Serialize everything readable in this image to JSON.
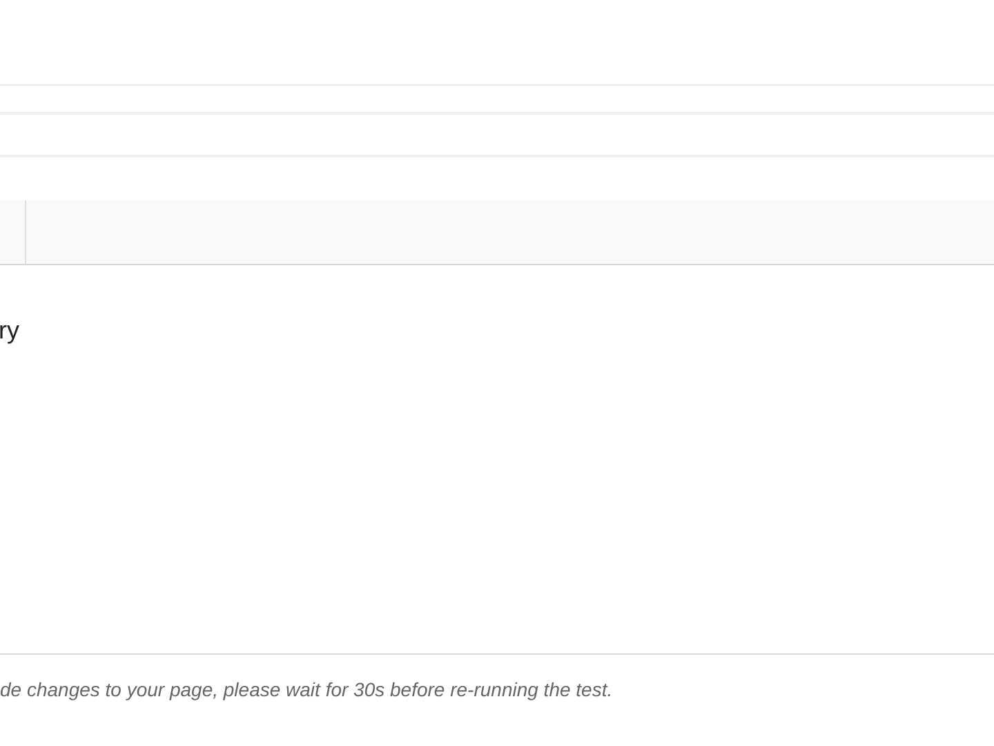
{
  "section": {
    "heading": "ry"
  },
  "footer": {
    "note": "de changes to your page, please wait for 30s before re-running the test."
  }
}
